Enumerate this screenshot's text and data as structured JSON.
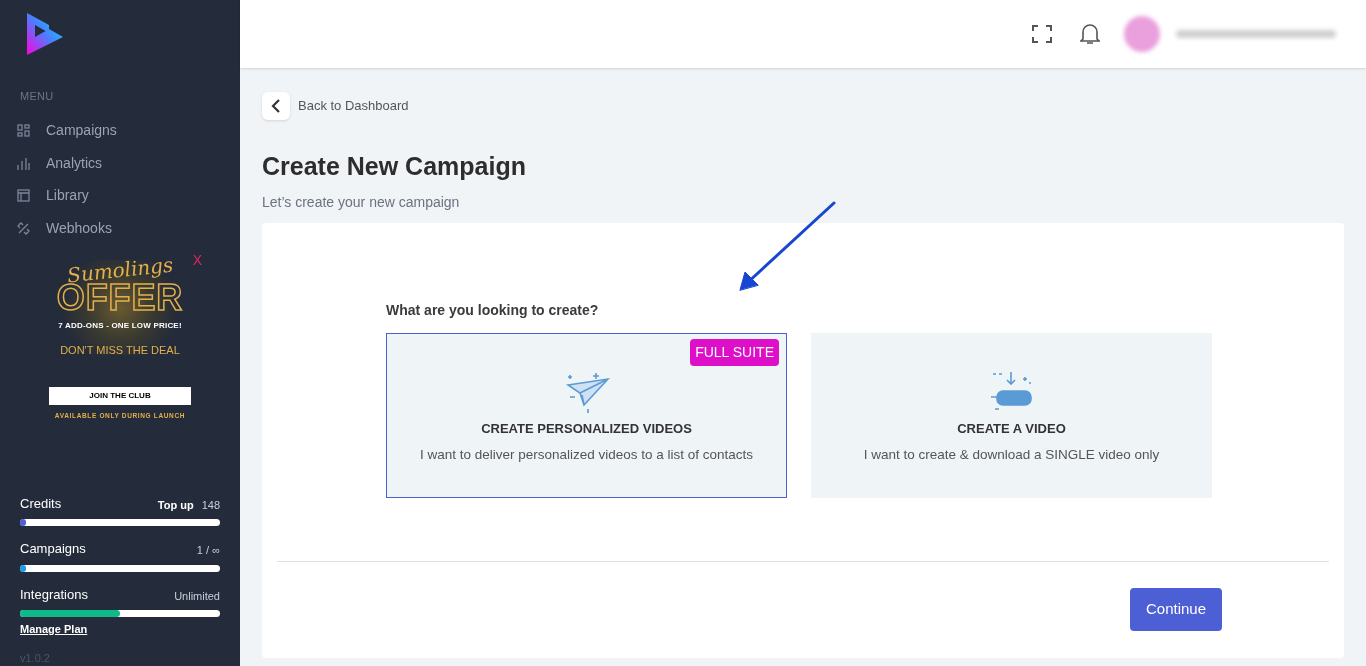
{
  "sidebar": {
    "menu_heading": "MENU",
    "items": [
      {
        "label": "Campaigns"
      },
      {
        "label": "Analytics"
      },
      {
        "label": "Library"
      },
      {
        "label": "Webhooks"
      }
    ],
    "promo": {
      "close": "X",
      "script_title": "Sumolings",
      "title": "OFFER",
      "subtitle": "7 ADD-ONS - ONE LOW PRICE!",
      "tagline": "DON'T MISS THE DEAL",
      "button": "JOIN THE CLUB",
      "note": "AVAILABLE ONLY DURING LAUNCH"
    },
    "usage": [
      {
        "label": "Credits",
        "action": "Top up",
        "reading": "148",
        "level": 0.02,
        "color": "#4f5fd6"
      },
      {
        "label": "Campaigns",
        "reading": "1 / ∞",
        "level": 0.01,
        "color": "#1e9be9"
      },
      {
        "label": "Integrations",
        "reading": "Unlimited",
        "level": 0.5,
        "color": "#10b98a"
      }
    ],
    "manage_plan": "Manage Plan",
    "version": "v1.0.2"
  },
  "back_link": "Back to Dashboard",
  "page_title": "Create New Campaign",
  "page_subtitle": "Let’s create your new campaign",
  "question": "What are you looking to create?",
  "options": [
    {
      "title": "CREATE PERSONALIZED VIDEOS",
      "description": "I want to deliver personalized videos to a list of contacts",
      "badge": "FULL SUITE",
      "selected": true
    },
    {
      "title": "CREATE A VIDEO",
      "description": "I want to create & download a SINGLE video only",
      "selected": false
    }
  ],
  "continue_button": "Continue"
}
